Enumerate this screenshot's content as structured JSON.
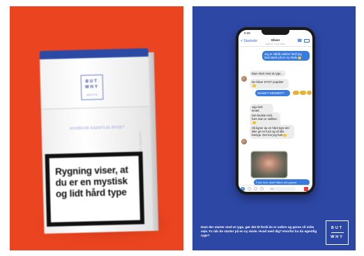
{
  "colors": {
    "left_background": "#ea4420",
    "right_background": "#2d47a5",
    "pack_band": "#2b4aa6",
    "bubble_out": "#3a7be0",
    "bubble_in": "#ececec"
  },
  "pack": {
    "logo_line1": "BUT",
    "logo_line2": "WHY",
    "logo_tiny": "BRUTA",
    "tagline": "HVORFOR EGENTLIG RYGE?",
    "side_text": "ERFARET BARE AF SKATTEN",
    "warning": "Rygning viser, at du er en mystisk og lidt hård type"
  },
  "phone": {
    "time": "9:38",
    "back_label": "< Startside",
    "contact_name": "Oliver",
    "contact_sub": "Aktiv for 1 time siden",
    "phone_icon": "☎",
    "messages": [
      {
        "dir": "out",
        "text": "Jeg er stådå usikker fordi jeg skal starte på en ny skole"
      },
      {
        "dir": "in",
        "text": "Bare start med at ryge..."
      },
      {
        "dir": "in",
        "text": "Du bliver SYGT populær"
      },
      {
        "dir": "out",
        "text": "Seriøst?! SERIØST?"
      },
      {
        "dir": "in",
        "text": "Jaja helt smart."
      },
      {
        "dir": "in",
        "text": "Det bedste trick, hvis man er usikker."
      },
      {
        "dir": "in",
        "text": "Så ligner du en hård type der ikke gir en fuck og vil alle hænge. Det har jeg hørt"
      },
      {
        "dir": "out",
        "text": "Fuck hvor vildt! Håber det passer"
      }
    ],
    "composer_placeholder": "Aa"
  },
  "caption": "Dem der starter med at ryge, gør det tit fordi de er usikre og gerne vil virke seje. Fx når de starter på en ny skole. Hvad med dig? Hvorfor ku du egentlig ryge?",
  "logo": {
    "line1": "BUT",
    "line2": "WHY"
  }
}
